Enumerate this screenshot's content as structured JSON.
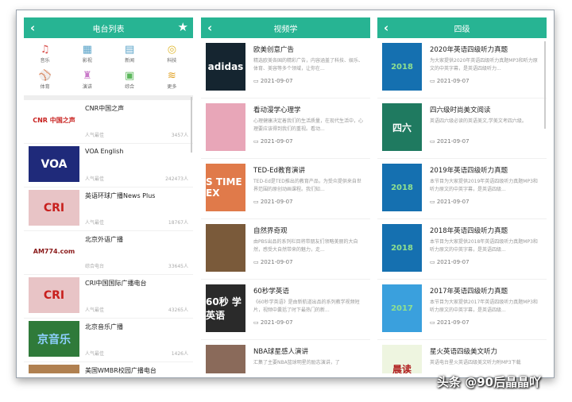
{
  "radio": {
    "title": "电台列表",
    "categories": [
      {
        "label": "音乐",
        "icon": "music-icon",
        "glyph": "♫",
        "color": "#d9534f"
      },
      {
        "label": "影视",
        "icon": "film-icon",
        "glyph": "▦",
        "color": "#5ba4c9"
      },
      {
        "label": "新闻",
        "icon": "news-icon",
        "glyph": "▤",
        "color": "#5ba4c9"
      },
      {
        "label": "科技",
        "icon": "planet-icon",
        "glyph": "◎",
        "color": "#e0b830"
      },
      {
        "label": "体育",
        "icon": "ball-icon",
        "glyph": "⚾",
        "color": "#9b6fc7"
      },
      {
        "label": "演讲",
        "icon": "podium-icon",
        "glyph": "♜",
        "color": "#c97ac9"
      },
      {
        "label": "综合",
        "icon": "grid-icon",
        "glyph": "▣",
        "color": "#5cb85c"
      },
      {
        "label": "更多",
        "icon": "layers-icon",
        "glyph": "≋",
        "color": "#e0a020"
      }
    ],
    "stations": [
      {
        "title": "CNR中国之声",
        "tag": "人气最佳",
        "count": "3457人",
        "logo": "CNR 中国之声",
        "bg": "#fff",
        "fg": "#c8201e"
      },
      {
        "title": "VOA English",
        "tag": "人气最佳",
        "count": "242473人",
        "logo": "VOA",
        "bg": "#1f2a7a",
        "fg": "#fff"
      },
      {
        "title": "英语环球广播News Plus",
        "tag": "人气最佳",
        "count": "18767人",
        "logo": "CRI",
        "bg": "#e8c4c6",
        "fg": "#c8201e"
      },
      {
        "title": "北京外语广播",
        "tag": "综合电台",
        "count": "33645人",
        "logo": "AM774.com",
        "bg": "#fff",
        "fg": "#8a1a1a"
      },
      {
        "title": "CRI中国国际广播电台",
        "tag": "人气最佳",
        "count": "43265人",
        "logo": "CRI",
        "bg": "#e8c4c6",
        "fg": "#c8201e"
      },
      {
        "title": "北京音乐广播",
        "tag": "人气最佳",
        "count": "1426人",
        "logo": "京音乐",
        "bg": "#2f7a3a",
        "fg": "#8fd0ff"
      },
      {
        "title": "美国WMBR校园广播电台",
        "tag": "",
        "count": "",
        "logo": "",
        "bg": "#b08050",
        "fg": "#fff"
      }
    ]
  },
  "video": {
    "title": "视频学",
    "items": [
      {
        "title": "欧美创意广告",
        "desc": "精选欧美各国的精彩广告，内容涵盖了科技、娱乐、体育、美容等多个领域，让你在...",
        "date": "2021-09-07",
        "logo": "adidas",
        "bg": "#152530"
      },
      {
        "title": "看动漫学心理学",
        "desc": "心理健康决定着我们的生活质量，在现代生活中，心理要应该得到我们的重视。看动...",
        "date": "2021-09-07",
        "logo": "",
        "bg": "#e8a6b8"
      },
      {
        "title": "TED-Ed教育演讲",
        "desc": "TED-Ed是TED推出的教育产品，为受众提供来自世界范围的原创动画课程。我们知...",
        "date": "2021-09-07",
        "logo": "S TIME EX",
        "bg": "#e07a4a"
      },
      {
        "title": "自然界奇观",
        "desc": "由PBS出品的系列栏目将带朋友们领略美丽的大自然，感受大自然带来的魅力，走...",
        "date": "2021-09-07",
        "logo": "",
        "bg": "#7a5a3a"
      },
      {
        "title": "60秒学英语",
        "desc": "《60秒学英语》是由新航道出品的系列教学视频短片，视频中囊括了时下最热门的新...",
        "date": "2021-09-07",
        "logo": "60秒 学英语",
        "bg": "#2a2a2a"
      },
      {
        "title": "NBA球星感人演讲",
        "desc": "汇集了主要NBA篮球明星的励志演讲，了",
        "date": "",
        "logo": "",
        "bg": "#8a6a5a"
      }
    ]
  },
  "cet4": {
    "title": "四级",
    "items": [
      {
        "title": "2020年英语四级听力真题",
        "desc": "为大家提供2020年英语四级听力真题MP3和听力原文的中英字幕，是英语四级听力...",
        "date": "2021-09-07",
        "logo": "2018",
        "bg": "#1570b0"
      },
      {
        "title": "四六级时尚美文阅读",
        "desc": "英语四六级必读的英语美文,学美文考四六级。",
        "date": "2021-09-07",
        "logo": "四六",
        "bg": "#1f7a60"
      },
      {
        "title": "2019年英语四级听力真题",
        "desc": "本节目为大家提供2019年英语四级听力真题MP3和听力原文的中英字幕，是英语四级...",
        "date": "2021-09-07",
        "logo": "2018",
        "bg": "#1570b0"
      },
      {
        "title": "2018年英语四级听力真题",
        "desc": "本节目为大家提供2018年英语四级听力真题MP3和听力原文的中英字幕，是英语四级...",
        "date": "2021-09-07",
        "logo": "2018",
        "bg": "#1570b0"
      },
      {
        "title": "2017年英语四级听力真题",
        "desc": "本节目为大家提供2017年英语四级听力真题MP3和听力原文的中英字幕，是英语四级...",
        "date": "2021-09-07",
        "logo": "2017",
        "bg": "#3aa0dd"
      },
      {
        "title": "星火英语四级美文听力",
        "desc": "英语电台星火英语四级美文听力附MP3下载",
        "date": "",
        "logo": "晨读",
        "bg": "#eef5e0"
      }
    ]
  },
  "watermark": "头条 @90后晶晶吖"
}
